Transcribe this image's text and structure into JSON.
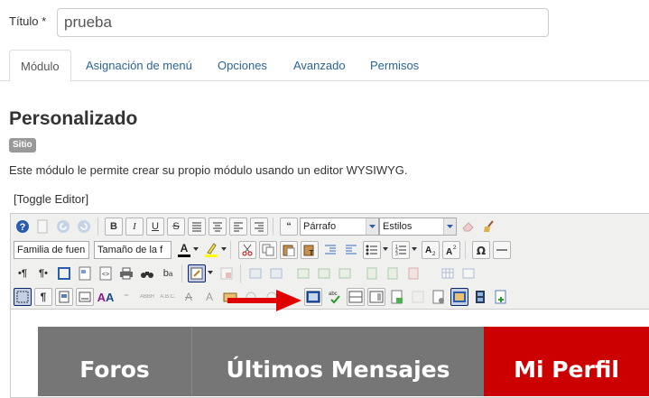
{
  "title_field": {
    "label": "Título *",
    "value": "prueba"
  },
  "tabs": [
    {
      "label": "Módulo",
      "active": true
    },
    {
      "label": "Asignación de menú",
      "active": false
    },
    {
      "label": "Opciones",
      "active": false
    },
    {
      "label": "Avanzado",
      "active": false
    },
    {
      "label": "Permisos",
      "active": false
    }
  ],
  "heading": "Personalizado",
  "badge": "Sitio",
  "description": "Este módulo le permite crear su propio módulo usando un editor WYSIWYG.",
  "toggle_editor": "[Toggle Editor]",
  "toolbar": {
    "format_select": "Párrafo",
    "styles_select": "Estilos",
    "font_family_select": "Familia de fuen",
    "font_size_select": "Tamaño de la f"
  },
  "colors": {
    "link": "#2a6496",
    "banner_gray": "#767676",
    "banner_red": "#cc0000",
    "arrow_red": "#e00000"
  },
  "banner": {
    "items": [
      {
        "label": "Foros"
      },
      {
        "label": "Últimos Mensajes"
      },
      {
        "label": "Mi Perfil"
      }
    ]
  }
}
